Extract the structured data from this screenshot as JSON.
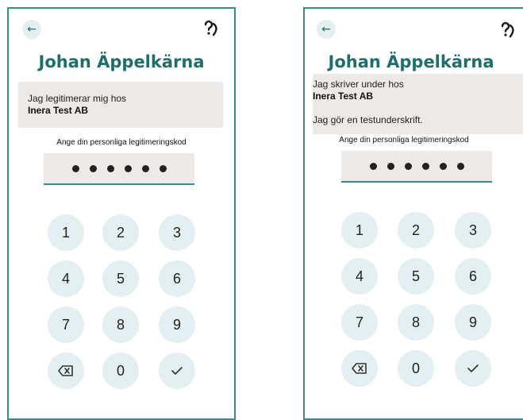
{
  "screens": [
    {
      "name": "Johan Äppelkärna",
      "info_lines": [
        "Jag legitimerar mig hos",
        "Inera Test AB"
      ],
      "pin_label": "Ange din personliga legitimeringskod",
      "pin_dots": 6,
      "keys": [
        "1",
        "2",
        "3",
        "4",
        "5",
        "6",
        "7",
        "8",
        "9",
        "0"
      ]
    },
    {
      "name": "Johan Äppelkärna",
      "info_lines": [
        "Jag skriver under hos",
        "Inera Test AB",
        "Jag gör en testunderskrift."
      ],
      "pin_label": "Ange din personliga legitimeringskod",
      "pin_dots": 6,
      "keys": [
        "1",
        "2",
        "3",
        "4",
        "5",
        "6",
        "7",
        "8",
        "9",
        "0"
      ]
    }
  ],
  "icons": {
    "back": "arrow-left",
    "help": "person-question",
    "backspace": "backspace",
    "confirm": "check"
  },
  "colors": {
    "accent": "#1f6e6b",
    "border": "#3a8c89",
    "key_bg": "#e3eff0",
    "panel_bg": "#ece9e6"
  }
}
